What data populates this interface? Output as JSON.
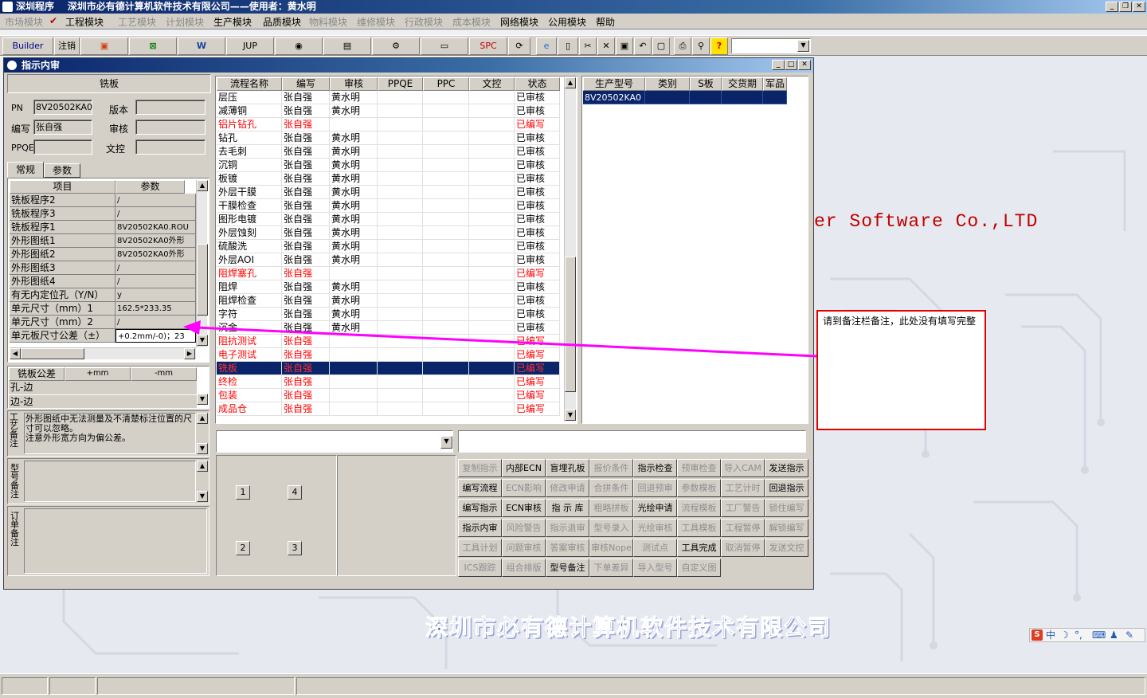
{
  "app": {
    "title": "深圳程序    深圳市必有德计算机软件技术有限公司——使用者：黄水明"
  },
  "menu": [
    {
      "label": "市场模块",
      "enabled": false
    },
    {
      "label": "工程模块",
      "enabled": true
    },
    {
      "label": "工艺模块",
      "enabled": false
    },
    {
      "label": "计划模块",
      "enabled": false
    },
    {
      "label": "生产模块",
      "enabled": true
    },
    {
      "label": "品质模块",
      "enabled": true
    },
    {
      "label": "物料模块",
      "enabled": false
    },
    {
      "label": "维修模块",
      "enabled": false
    },
    {
      "label": "行政模块",
      "enabled": false
    },
    {
      "label": "成本模块",
      "enabled": false
    },
    {
      "label": "网络模块",
      "enabled": true
    },
    {
      "label": "公用模块",
      "enabled": true
    },
    {
      "label": "帮助",
      "enabled": true
    }
  ],
  "toolbar": {
    "builder": "Builder",
    "logout": "注销",
    "jup": "JUP",
    "spc": "SPC"
  },
  "window": {
    "title": "指示内审"
  },
  "left": {
    "section_title": "铣板",
    "pn_label": "PN",
    "pn_value": "8V20502KA0",
    "version_label": "版本",
    "version_value": "",
    "author_label": "编写",
    "author_value": "张自强",
    "review_label": "审核",
    "review_value": "",
    "ppqe_label": "PPQE",
    "ppqe_value": "",
    "doc_label": "文控",
    "doc_value": "",
    "tabs": [
      "常规",
      "参数"
    ],
    "param_headers": [
      "项目",
      "参数"
    ],
    "params": [
      [
        "铣板程序2",
        "/"
      ],
      [
        "铣板程序3",
        "/"
      ],
      [
        "铣板程序1",
        "8V20502KA0.ROU"
      ],
      [
        "外形图纸1",
        "8V20502KA0外形"
      ],
      [
        "外形图纸2",
        "8V20502KA0外形"
      ],
      [
        "外形图纸3",
        "/"
      ],
      [
        "外形图纸4",
        "/"
      ],
      [
        "有无内定位孔（Y/N）",
        "y"
      ],
      [
        "单元尺寸（mm）1",
        "162.5*233.35"
      ],
      [
        "单元尺寸（mm）2",
        "/"
      ],
      [
        "单元板尺寸公差（±）",
        "+0.2mm/-0)；23"
      ]
    ],
    "tol_headers": [
      "铣板公差",
      "+mm",
      "-mm"
    ],
    "tol_rows": [
      "孔-边",
      "边-边"
    ],
    "process_note_label": "工艺备注",
    "process_note": "外形图纸中无法测量及不清楚标注位置的尺寸可以忽略。\n注意外形宽方向为偏公差。",
    "model_note_label": "型号备注",
    "order_note_label": "订单备注"
  },
  "flow": {
    "headers": [
      "流程名称",
      "编写",
      "审核",
      "PPQE",
      "PPC",
      "文控",
      "状态"
    ],
    "rows": [
      {
        "name": "层压",
        "author": "张自强",
        "reviewer": "黄水明",
        "status": "已审核",
        "red": false
      },
      {
        "name": "减薄铜",
        "author": "张自强",
        "reviewer": "黄水明",
        "status": "已审核",
        "red": false
      },
      {
        "name": "铝片钻孔",
        "author": "张自强",
        "reviewer": "",
        "status": "已编写",
        "red": true
      },
      {
        "name": "钻孔",
        "author": "张自强",
        "reviewer": "黄水明",
        "status": "已审核",
        "red": false
      },
      {
        "name": "去毛刺",
        "author": "张自强",
        "reviewer": "黄水明",
        "status": "已审核",
        "red": false
      },
      {
        "name": "沉铜",
        "author": "张自强",
        "reviewer": "黄水明",
        "status": "已审核",
        "red": false
      },
      {
        "name": "板镀",
        "author": "张自强",
        "reviewer": "黄水明",
        "status": "已审核",
        "red": false
      },
      {
        "name": "外层干膜",
        "author": "张自强",
        "reviewer": "黄水明",
        "status": "已审核",
        "red": false
      },
      {
        "name": "干膜检查",
        "author": "张自强",
        "reviewer": "黄水明",
        "status": "已审核",
        "red": false
      },
      {
        "name": "图形电镀",
        "author": "张自强",
        "reviewer": "黄水明",
        "status": "已审核",
        "red": false
      },
      {
        "name": "外层蚀刻",
        "author": "张自强",
        "reviewer": "黄水明",
        "status": "已审核",
        "red": false
      },
      {
        "name": "硫酸洗",
        "author": "张自强",
        "reviewer": "黄水明",
        "status": "已审核",
        "red": false
      },
      {
        "name": "外层AOI",
        "author": "张自强",
        "reviewer": "黄水明",
        "status": "已审核",
        "red": false
      },
      {
        "name": "阻焊塞孔",
        "author": "张自强",
        "reviewer": "",
        "status": "已编写",
        "red": true
      },
      {
        "name": "阻焊",
        "author": "张自强",
        "reviewer": "黄水明",
        "status": "已审核",
        "red": false
      },
      {
        "name": "阻焊检查",
        "author": "张自强",
        "reviewer": "黄水明",
        "status": "已审核",
        "red": false
      },
      {
        "name": "字符",
        "author": "张自强",
        "reviewer": "黄水明",
        "status": "已审核",
        "red": false
      },
      {
        "name": "沉金",
        "author": "张自强",
        "reviewer": "黄水明",
        "status": "已审核",
        "red": false
      },
      {
        "name": "阻抗测试",
        "author": "张自强",
        "reviewer": "",
        "status": "已编写",
        "red": true
      },
      {
        "name": "电子测试",
        "author": "张自强",
        "reviewer": "",
        "status": "已编写",
        "red": true
      },
      {
        "name": "铣板",
        "author": "张自强",
        "reviewer": "",
        "status": "已编写",
        "red": true,
        "selected": true
      },
      {
        "name": "终检",
        "author": "张自强",
        "reviewer": "",
        "status": "已编写",
        "red": true
      },
      {
        "name": "包装",
        "author": "张自强",
        "reviewer": "",
        "status": "已编写",
        "red": true
      },
      {
        "name": "成品仓",
        "author": "张自强",
        "reviewer": "",
        "status": "已编写",
        "red": true
      }
    ]
  },
  "model": {
    "headers": [
      "生产型号",
      "类别",
      "S板",
      "交货期",
      "军品"
    ],
    "rows": [
      [
        "8V20502KA0",
        "",
        "",
        "",
        ""
      ]
    ]
  },
  "pad_buttons": [
    "1",
    "4",
    "2",
    "3"
  ],
  "buttons": [
    [
      {
        "l": "复制指示",
        "e": false
      },
      {
        "l": "内部ECN",
        "e": true
      },
      {
        "l": "盲埋孔板",
        "e": true
      },
      {
        "l": "报价条件",
        "e": false
      },
      {
        "l": "指示检查",
        "e": true
      },
      {
        "l": "预审检查",
        "e": false
      },
      {
        "l": "导入CAM",
        "e": false
      },
      {
        "l": "发送指示",
        "e": true
      }
    ],
    [
      {
        "l": "编写流程",
        "e": true
      },
      {
        "l": "ECN影响",
        "e": false
      },
      {
        "l": "修改申请",
        "e": false
      },
      {
        "l": "合拼条件",
        "e": false
      },
      {
        "l": "回退预审",
        "e": false
      },
      {
        "l": "参数模板",
        "e": false
      },
      {
        "l": "工艺计时",
        "e": false
      },
      {
        "l": "回退指示",
        "e": true
      }
    ],
    [
      {
        "l": "编写指示",
        "e": true
      },
      {
        "l": "ECN审核",
        "e": true
      },
      {
        "l": "指 示 库",
        "e": true
      },
      {
        "l": "粗略拼板",
        "e": false
      },
      {
        "l": "光绘申请",
        "e": true
      },
      {
        "l": "流程模板",
        "e": false
      },
      {
        "l": "工厂警告",
        "e": false
      },
      {
        "l": "锁住编写",
        "e": false
      }
    ],
    [
      {
        "l": "指示内审",
        "e": true
      },
      {
        "l": "风险警告",
        "e": false
      },
      {
        "l": "指示退审",
        "e": false
      },
      {
        "l": "型号录入",
        "e": false
      },
      {
        "l": "光绘审核",
        "e": false
      },
      {
        "l": "工具模板",
        "e": false
      },
      {
        "l": "工程暂停",
        "e": false
      },
      {
        "l": "解锁编写",
        "e": false
      }
    ],
    [
      {
        "l": "工具计划",
        "e": false
      },
      {
        "l": "问题审核",
        "e": false
      },
      {
        "l": "答案审核",
        "e": false
      },
      {
        "l": "审核Nope",
        "e": false
      },
      {
        "l": "测试点",
        "e": false
      },
      {
        "l": "工具完成",
        "e": true
      },
      {
        "l": "取消暂停",
        "e": false
      },
      {
        "l": "发送文控",
        "e": false
      }
    ],
    [
      {
        "l": "ICS跟踪",
        "e": false
      },
      {
        "l": "组合排版",
        "e": false
      },
      {
        "l": "型号备注",
        "e": true
      },
      {
        "l": "下单差异",
        "e": false
      },
      {
        "l": "导入型号",
        "e": false
      },
      {
        "l": "自定义图",
        "e": false
      }
    ]
  ],
  "callout": {
    "text": "请到备注栏备注，此处没有填写完整"
  },
  "desktop": {
    "banner_en": "er Software Co.,LTD",
    "banner_cn": "深圳市必有德计算机软件技术有限公司",
    "ime": "中"
  },
  "colors": {
    "title": "#0a246a",
    "face": "#d4d0c8",
    "red": "#ff0000",
    "arrow": "#ff00ff",
    "selected": "#0a246a"
  }
}
